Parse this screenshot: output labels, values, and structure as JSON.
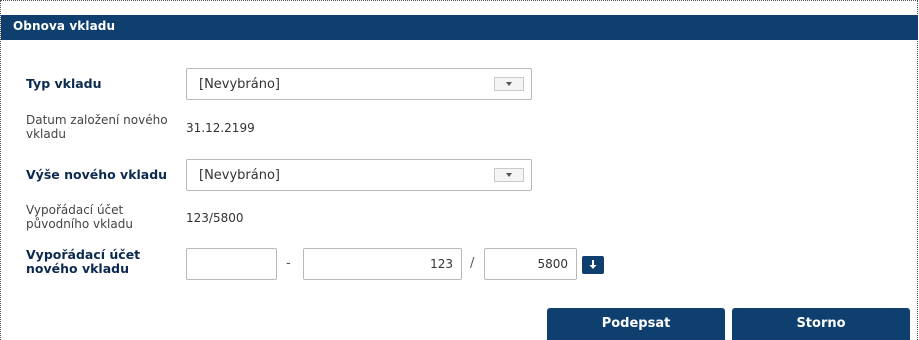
{
  "panel": {
    "title": "Obnova vkladu"
  },
  "form": {
    "deposit_type": {
      "label": "Typ vkladu",
      "selected": "[Nevybráno]"
    },
    "creation_date": {
      "label_line1": "Datum založení nového",
      "label_line2": "vkladu",
      "value": "31.12.2199"
    },
    "new_amount": {
      "label": "Výše nového vkladu",
      "selected": "[Nevybráno]"
    },
    "original_account": {
      "label_line1": "Vypořádací účet",
      "label_line2": "původního vkladu",
      "value": "123/5800"
    },
    "new_account": {
      "label_line1": "Vypořádací účet",
      "label_line2": "nového vkladu",
      "prefix": "",
      "prefix_separator": "-",
      "number": "123",
      "bank_separator": "/",
      "bank_code": "5800"
    }
  },
  "actions": {
    "sign": "Podepsat",
    "cancel": "Storno"
  },
  "icons": {
    "account_pick": "arrow-down-icon"
  },
  "colors": {
    "primary": "#0e3f6e"
  }
}
